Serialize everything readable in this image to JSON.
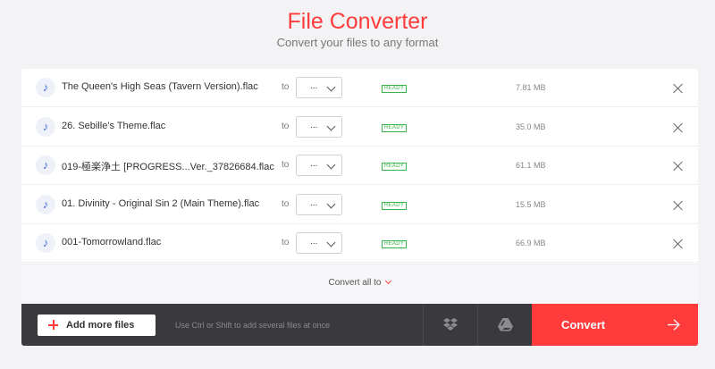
{
  "header": {
    "title": "File Converter",
    "subtitle": "Convert your files to any format"
  },
  "files": [
    {
      "name": "The Queen's High Seas (Tavern Version).flac",
      "to": "to",
      "format": "...",
      "status": "READY",
      "size": "7.81 MB",
      "icon": "music-note-icon"
    },
    {
      "name": "26. Sebille's Theme.flac",
      "to": "to",
      "format": "...",
      "status": "READY",
      "size": "35.0 MB",
      "icon": "music-note-icon"
    },
    {
      "name": "019-極楽浄土 [PROGRESS...Ver._37826684.flac",
      "to": "to",
      "format": "...",
      "status": "READY",
      "size": "61.1 MB",
      "icon": "music-note-icon"
    },
    {
      "name": "01. Divinity - Original Sin 2 (Main Theme).flac",
      "to": "to",
      "format": "...",
      "status": "READY",
      "size": "15.5 MB",
      "icon": "music-note-icon"
    },
    {
      "name": "001-Tomorrowland.flac",
      "to": "to",
      "format": "...",
      "status": "READY",
      "size": "66.9 MB",
      "icon": "music-note-icon"
    }
  ],
  "convert_all": {
    "label": "Convert all to"
  },
  "action_bar": {
    "add_files_label": "Add more files",
    "hint": "Use Ctrl or Shift to add several files at once",
    "dropbox_icon": "dropbox-icon",
    "drive_icon": "google-drive-icon",
    "convert_label": "Convert"
  },
  "colors": {
    "accent": "#ff3b3b",
    "ready": "#3bb54a",
    "bar": "#3a3a3d"
  }
}
